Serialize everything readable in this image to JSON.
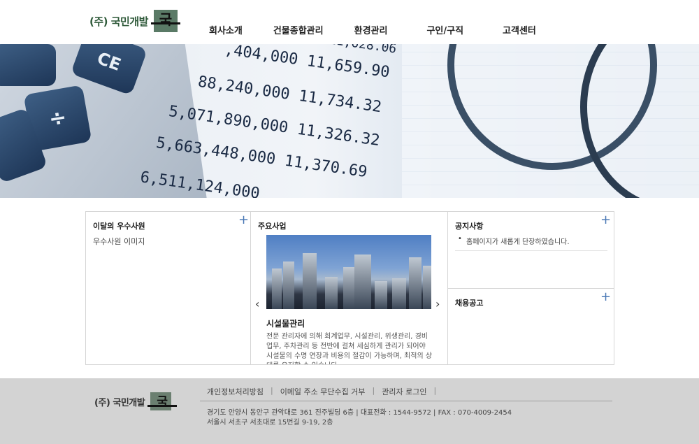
{
  "header": {
    "logo_text": "(주) 국민개발",
    "logo_mark_text": "국",
    "nav": [
      "회사소개",
      "건물종합관리",
      "환경관리",
      "구인/구직",
      "고객센터"
    ]
  },
  "panels": {
    "employee": {
      "title": "이달의 우수사원",
      "text": "우수사원 이미지",
      "plus": "+"
    },
    "business": {
      "title": "주요사업",
      "prev": "‹",
      "next": "›",
      "slide_title": "시설물관리",
      "slide_desc": "전문 관리자에 의해 회계업무, 시설관리, 위생관리, 경비업무, 주차관리 등 전반에 걸쳐 세심하게 관리가 되어야 시설물의 수명 연장과 비용의 절감이 가능하며, 최적의 상태를 유지할 수 있습니다."
    },
    "notice": {
      "title": "공지사항",
      "items": [
        "홈페이지가 새롭게 단장하였습니다."
      ],
      "plus": "+"
    },
    "recruit": {
      "title": "채용공고",
      "plus": "+"
    }
  },
  "footer": {
    "logo_text": "(주) 국민개발",
    "logo_mark_text": "국",
    "links": [
      "개인정보처리방침",
      "이메일 주소 무단수집 거부",
      "관리자 로그인"
    ],
    "address_line1": "경기도 안양시 동안구 관악대로 361 진주빌딩 6층 | 대표전화 : 1544-9572 | FAX : 070-4009-2454",
    "address_line2": "서울시 서초구 서초대로 15번길 9-19, 2층"
  },
  "colors": {
    "brand_green": "#2f5a3a",
    "plus_blue": "#4a78b5",
    "footer_bg": "#d3d3d3"
  }
}
